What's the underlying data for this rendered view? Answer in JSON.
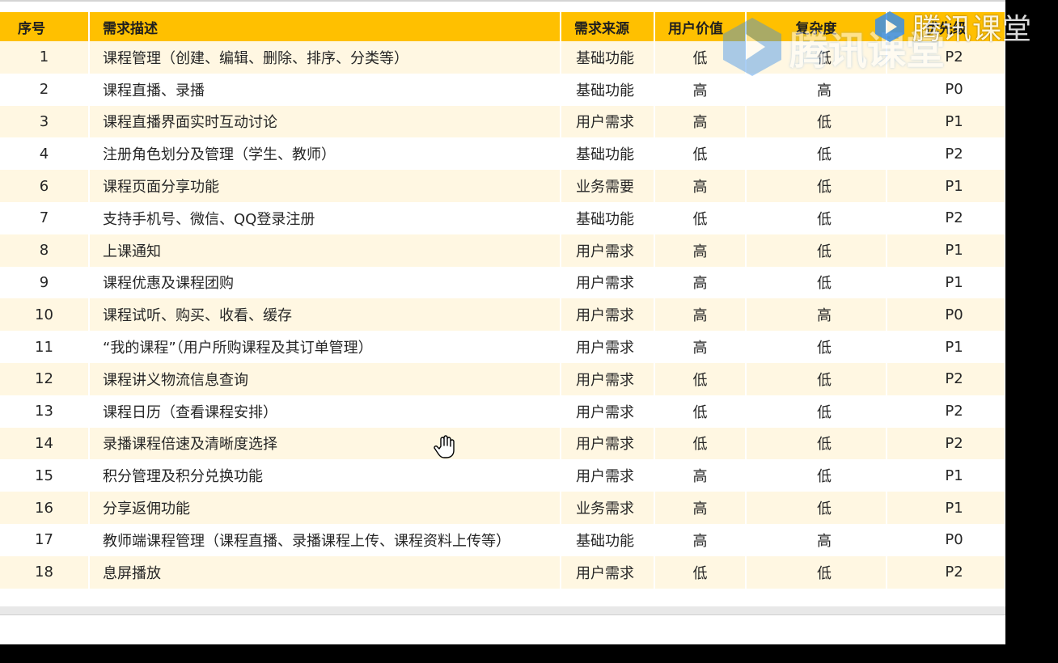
{
  "table": {
    "headers": [
      "序号",
      "需求描述",
      "需求来源",
      "用户价值",
      "复杂度",
      "优先级"
    ],
    "rows": [
      [
        "1",
        "课程管理（创建、编辑、删除、排序、分类等）",
        "基础功能",
        "低",
        "低",
        "P2"
      ],
      [
        "2",
        "课程直播、录播",
        "基础功能",
        "高",
        "高",
        "P0"
      ],
      [
        "3",
        "课程直播界面实时互动讨论",
        "用户需求",
        "高",
        "低",
        "P1"
      ],
      [
        "4",
        "注册角色划分及管理（学生、教师）",
        "基础功能",
        "低",
        "低",
        "P2"
      ],
      [
        "6",
        "课程页面分享功能",
        "业务需要",
        "高",
        "低",
        "P1"
      ],
      [
        "7",
        "支持手机号、微信、QQ登录注册",
        "基础功能",
        "低",
        "低",
        "P2"
      ],
      [
        "8",
        "上课通知",
        "用户需求",
        "高",
        "低",
        "P1"
      ],
      [
        "9",
        "课程优惠及课程团购",
        "用户需求",
        "高",
        "低",
        "P1"
      ],
      [
        "10",
        "课程试听、购买、收看、缓存",
        "用户需求",
        "高",
        "高",
        "P0"
      ],
      [
        "11",
        "“我的课程”（用户所购课程及其订单管理）",
        "用户需求",
        "高",
        "低",
        "P1"
      ],
      [
        "12",
        "课程讲义物流信息查询",
        "用户需求",
        "低",
        "低",
        "P2"
      ],
      [
        "13",
        "课程日历（查看课程安排）",
        "用户需求",
        "低",
        "低",
        "P2"
      ],
      [
        "14",
        "录播课程倍速及清晰度选择",
        "用户需求",
        "低",
        "低",
        "P2"
      ],
      [
        "15",
        "积分管理及积分兑换功能",
        "用户需求",
        "高",
        "低",
        "P1"
      ],
      [
        "16",
        "分享返佣功能",
        "业务需求",
        "高",
        "低",
        "P1"
      ],
      [
        "17",
        "教师端课程管理（课程直播、录播课程上传、课程资料上传等）",
        "基础功能",
        "高",
        "高",
        "P0"
      ],
      [
        "18",
        "息屏播放",
        "用户需求",
        "低",
        "低",
        "P2"
      ]
    ]
  },
  "watermark": {
    "text": "腾讯课堂",
    "icon": "play-logo-icon"
  },
  "colors": {
    "header_bg": "#ffc000",
    "stripe_bg": "#fff7e2"
  },
  "cursor": {
    "icon": "hand-pointer-icon"
  }
}
